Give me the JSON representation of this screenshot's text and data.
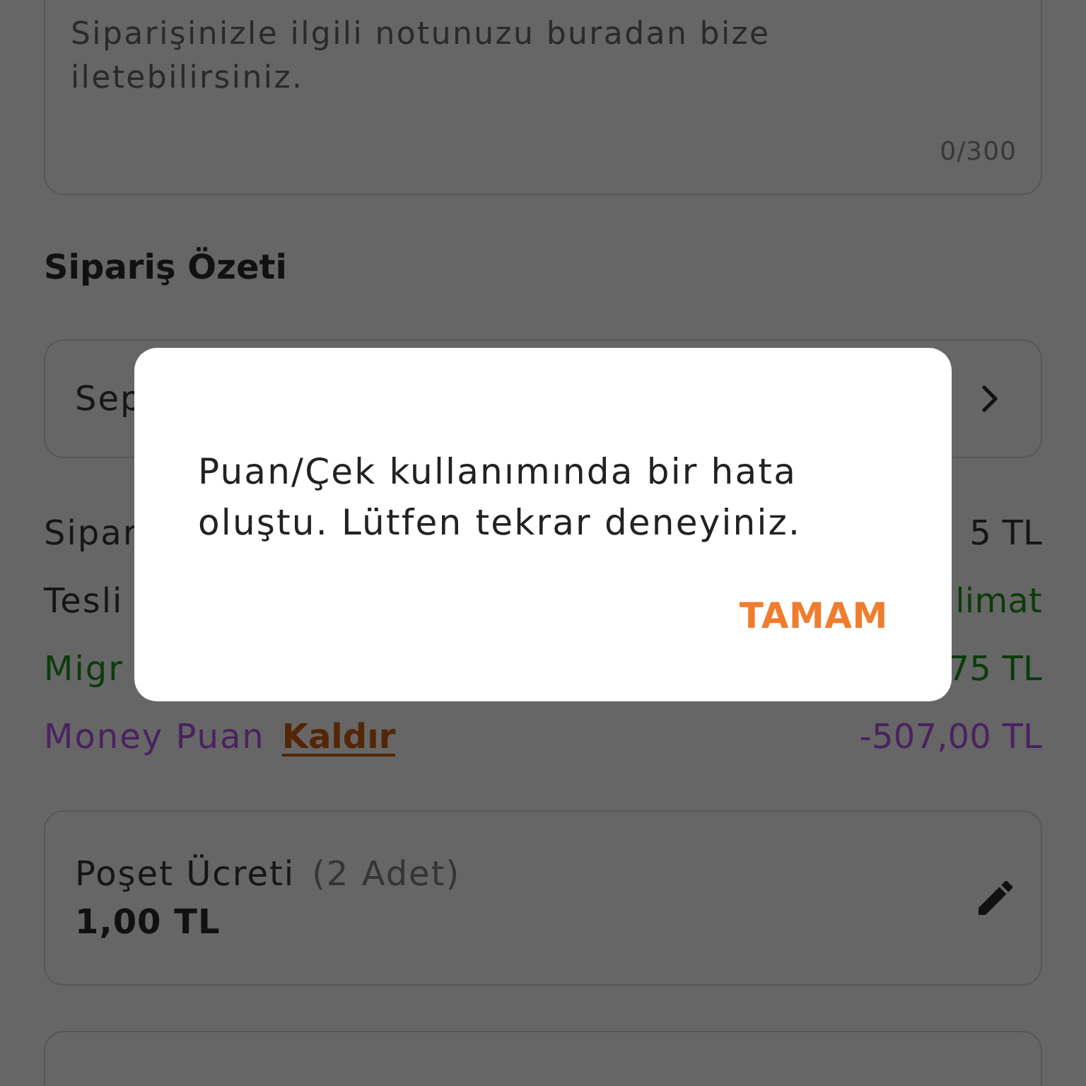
{
  "note_field": {
    "placeholder": "Siparişinizle ilgili notunuzu buradan bize iletebilirsiniz.",
    "counter": "0/300"
  },
  "order_summary": {
    "title": "Sipariş Özeti",
    "cart_link": {
      "label": "Sep"
    },
    "rows": [
      {
        "kind": "plain",
        "label": "Sipar",
        "value": "5 TL"
      },
      {
        "kind": "free_delivery",
        "label": "Tesli",
        "value": "limat"
      },
      {
        "kind": "discount",
        "label": "Migr",
        "value": "75 TL"
      },
      {
        "kind": "points",
        "label": "Money Puan",
        "action": "Kaldır",
        "value": "-507,00 TL"
      }
    ]
  },
  "bag_fee": {
    "label": "Poşet Ücreti",
    "quantity": "(2 Adet)",
    "price": "1,00 TL"
  },
  "dialog": {
    "message": "Puan/Çek kullanımında bir hata oluştu. Lütfen tekrar deneyiniz.",
    "button": "TAMAM"
  }
}
